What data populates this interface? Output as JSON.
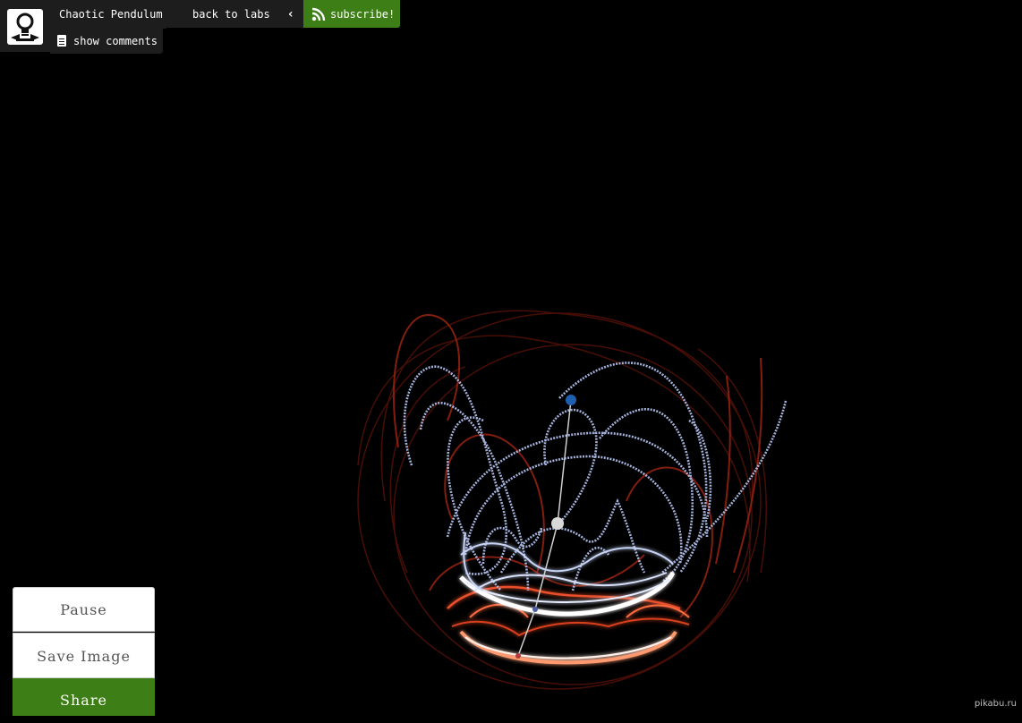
{
  "header": {
    "app_title": "Chaotic Pendulum",
    "back_label": "back to labs",
    "subscribe_label": "subscribe!",
    "comments_label": "show comments"
  },
  "icons": {
    "logo": "lightbulb-logo-icon",
    "back": "chevron-left-icon",
    "rss": "rss-icon",
    "comments": "document-icon"
  },
  "controls": {
    "pause_label": "Pause",
    "save_label": "Save Image",
    "share_label": "Share"
  },
  "watermark": "pikabu.ru",
  "colors": {
    "accent_green": "#3e7e16",
    "bar_bg": "#1d1d1d",
    "trail_blue": "#b8c8f2",
    "trail_red": "#e8502c",
    "pivot_blue": "#1f5fb0"
  }
}
